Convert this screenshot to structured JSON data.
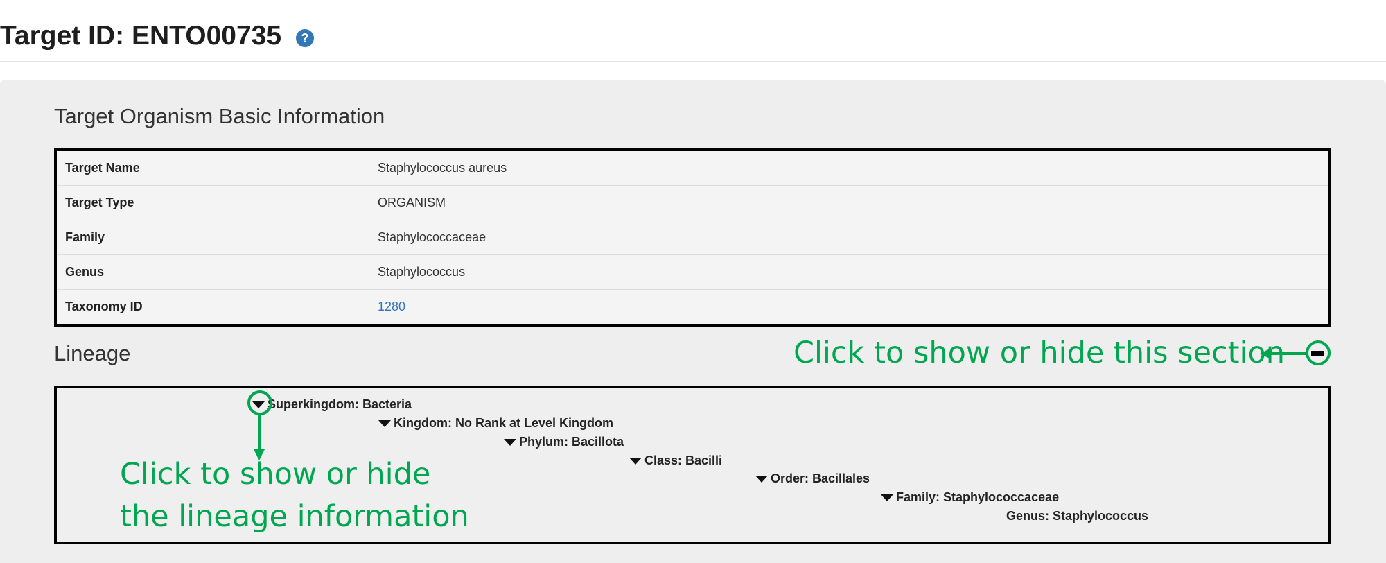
{
  "header": {
    "title": "Target ID: ENTO00735",
    "help_icon": "question-circle-icon"
  },
  "basic_info": {
    "title": "Target Organism Basic Information",
    "rows": [
      {
        "label": "Target Name",
        "value": "Staphylococcus aureus"
      },
      {
        "label": "Target Type",
        "value": "ORGANISM"
      },
      {
        "label": "Family",
        "value": "Staphylococcaceae"
      },
      {
        "label": "Genus",
        "value": "Staphylococcus"
      },
      {
        "label": "Taxonomy ID",
        "value": "1280"
      }
    ]
  },
  "lineage": {
    "title": "Lineage",
    "items": [
      {
        "text": "Superkingdom: Bacteria",
        "collapsible": true
      },
      {
        "text": "Kingdom: No Rank at Level Kingdom",
        "collapsible": true
      },
      {
        "text": "Phylum: Bacillota",
        "collapsible": true
      },
      {
        "text": "Class: Bacilli",
        "collapsible": true
      },
      {
        "text": "Order: Bacillales",
        "collapsible": true
      },
      {
        "text": "Family: Staphylococcaceae",
        "collapsible": true
      },
      {
        "text": "Genus: Staphylococcus",
        "collapsible": false
      }
    ]
  },
  "annotations": {
    "section_toggle": "Click to show or hide this section",
    "lineage_line1": "Click to show or hide",
    "lineage_line2": "the lineage information",
    "color": "#00a650"
  },
  "colors": {
    "link": "#3575b8",
    "help_icon": "#3477b7",
    "panel": "#eeeeee"
  }
}
